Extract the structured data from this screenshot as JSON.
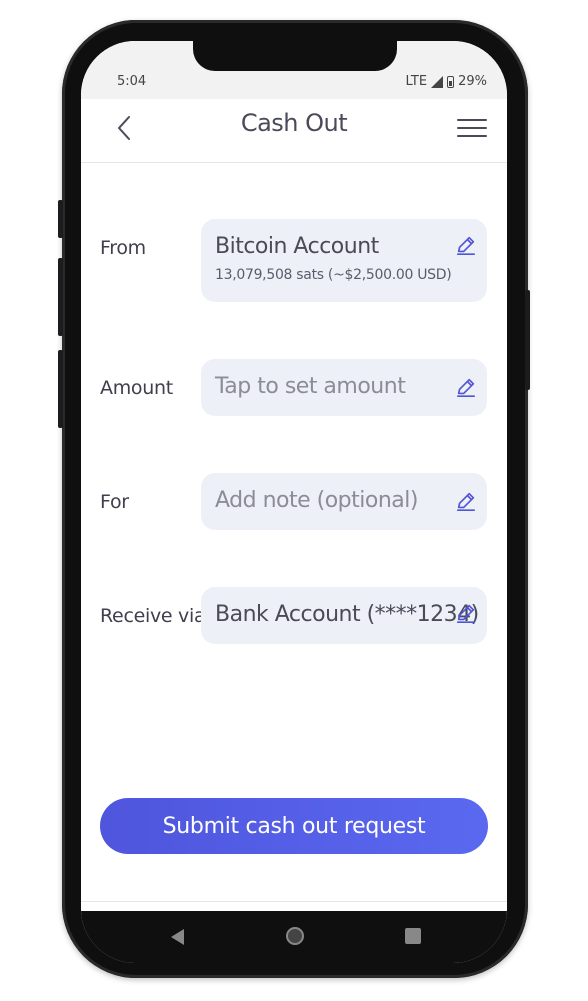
{
  "status_bar": {
    "time": "5:04",
    "network": "LTE",
    "battery": "29%"
  },
  "header": {
    "title": "Cash Out",
    "back_icon": "chevron-left-icon",
    "menu_icon": "hamburger-menu-icon"
  },
  "form": {
    "from": {
      "label": "From",
      "value": "Bitcoin Account",
      "balance": "13,079,508 sats  (~$2,500.00 USD)"
    },
    "amount": {
      "label": "Amount",
      "placeholder": "Tap to set amount"
    },
    "for": {
      "label": "For",
      "placeholder": "Add note (optional)"
    },
    "receive_via": {
      "label": "Receive via",
      "value": "Bank Account (****1234)"
    }
  },
  "submit_button": {
    "label": "Submit cash out request"
  },
  "colors": {
    "accent": "#5158E0",
    "field_bg": "#EEF0F7",
    "text": "#4A4A5A",
    "edit_icon": "#4F55D6"
  }
}
